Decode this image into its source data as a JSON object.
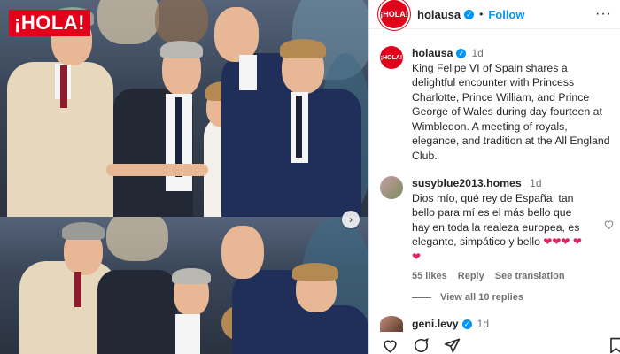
{
  "photo": {
    "logo_text": "¡HOLA!",
    "carousel_next": "›"
  },
  "header": {
    "avatar_text": "¡HOLA!",
    "username": "holausa",
    "verified": "✓",
    "dot": "•",
    "follow": "Follow",
    "more": "···"
  },
  "caption": {
    "avatar_text": "¡HOLA!",
    "username": "holausa",
    "verified": "✓",
    "time": "1d",
    "text": "King Felipe VI of Spain shares a delightful encounter with Princess Charlotte, Prince William, and Prince George of Wales during day fourteen at Wimbledon. A meeting of royals, elegance, and tradition at the All England Club."
  },
  "comment": {
    "username": "susyblue2013.homes",
    "time": "1d",
    "text": "Dios mío, qué rey de España, tan bello para mí es el más bello que hay en toda la realeza europea, es elegante, simpático y bello",
    "hearts": "❤❤❤ ❤❤",
    "likes": "55 likes",
    "reply": "Reply",
    "translate": "See translation",
    "view_replies": "View all 10 replies"
  },
  "comment2": {
    "username": "geni.levy",
    "time": "1d"
  },
  "icons": {
    "like": "heart-icon",
    "comment": "comment-icon",
    "share": "share-icon",
    "save": "bookmark-icon"
  }
}
